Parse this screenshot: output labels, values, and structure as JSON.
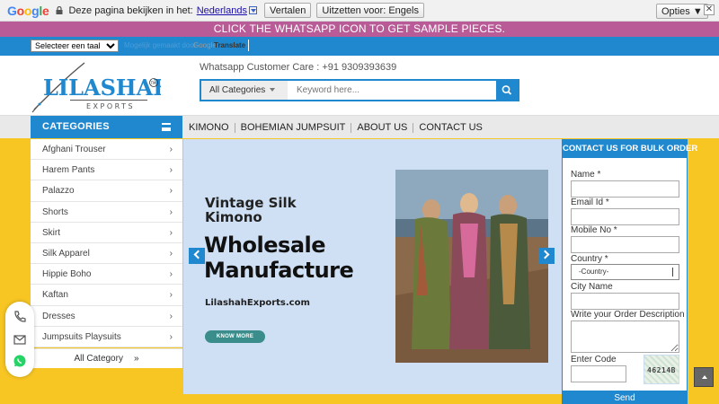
{
  "google_bar": {
    "logo_letters": [
      "G",
      "o",
      "o",
      "g",
      "l",
      "e"
    ],
    "logo_colors": [
      "#4285f4",
      "#ea4335",
      "#fbbc05",
      "#4285f4",
      "#34a853",
      "#ea4335"
    ],
    "ask_text": "Deze pagina bekijken in het:",
    "language_link": "Nederlands",
    "translate_button": "Vertalen",
    "turn_off_button": "Uitzetten voor: Engels",
    "options_button": "Opties ▼",
    "close_glyph": "✕"
  },
  "announcement": "CLICK THE WHATSAPP ICON TO GET SAMPLE PIECES.",
  "language_widget": {
    "select_value": "Selecteer een taal",
    "powered_by": "Mogelijk gemaakt door",
    "google_label": "Google",
    "translate_label": "Translate"
  },
  "header": {
    "logo_main": "LILASHAH",
    "logo_sub": "EXPORTS",
    "logo_tm": "TM",
    "whatsapp_care": "Whatsapp Customer Care : +91 9309393639",
    "search": {
      "category_value": "All Categories",
      "placeholder": "Keyword here..."
    }
  },
  "nav": {
    "categories_title": "CATEGORIES",
    "items": [
      "KIMONO",
      "BOHEMIAN JUMPSUIT",
      "ABOUT US",
      "CONTACT US"
    ]
  },
  "sidebar": {
    "items": [
      "Afghani Trouser",
      "Harem Pants",
      "Palazzo",
      "Shorts",
      "Skirt",
      "Silk Apparel",
      "Hippie Boho",
      "Kaftan",
      "Dresses",
      "Jumpsuits Playsuits"
    ],
    "chevron": "›",
    "all_category": "All Category",
    "all_category_icon": "»"
  },
  "hero": {
    "line1": "Vintage Silk Kimono",
    "line2": "Wholesale Manufacture",
    "site": "LilashahExports.com",
    "button": "KNOW MORE"
  },
  "bulk_form": {
    "title": "CONTACT US FOR BULK ORDER",
    "name_label": "Name *",
    "email_label": "Email Id *",
    "mobile_label": "Mobile No *",
    "country_label": "Country *",
    "country_value": "-Country-",
    "city_label": "City Name",
    "desc_label": "Write your Order Description",
    "code_label": "Enter Code",
    "captcha_text": "46214B",
    "send_button": "Send"
  },
  "colors": {
    "brand_blue": "#1f88cf",
    "announce_pink": "#b95b97",
    "background_yellow": "#f7c623",
    "whatsapp_green": "#25d366"
  }
}
